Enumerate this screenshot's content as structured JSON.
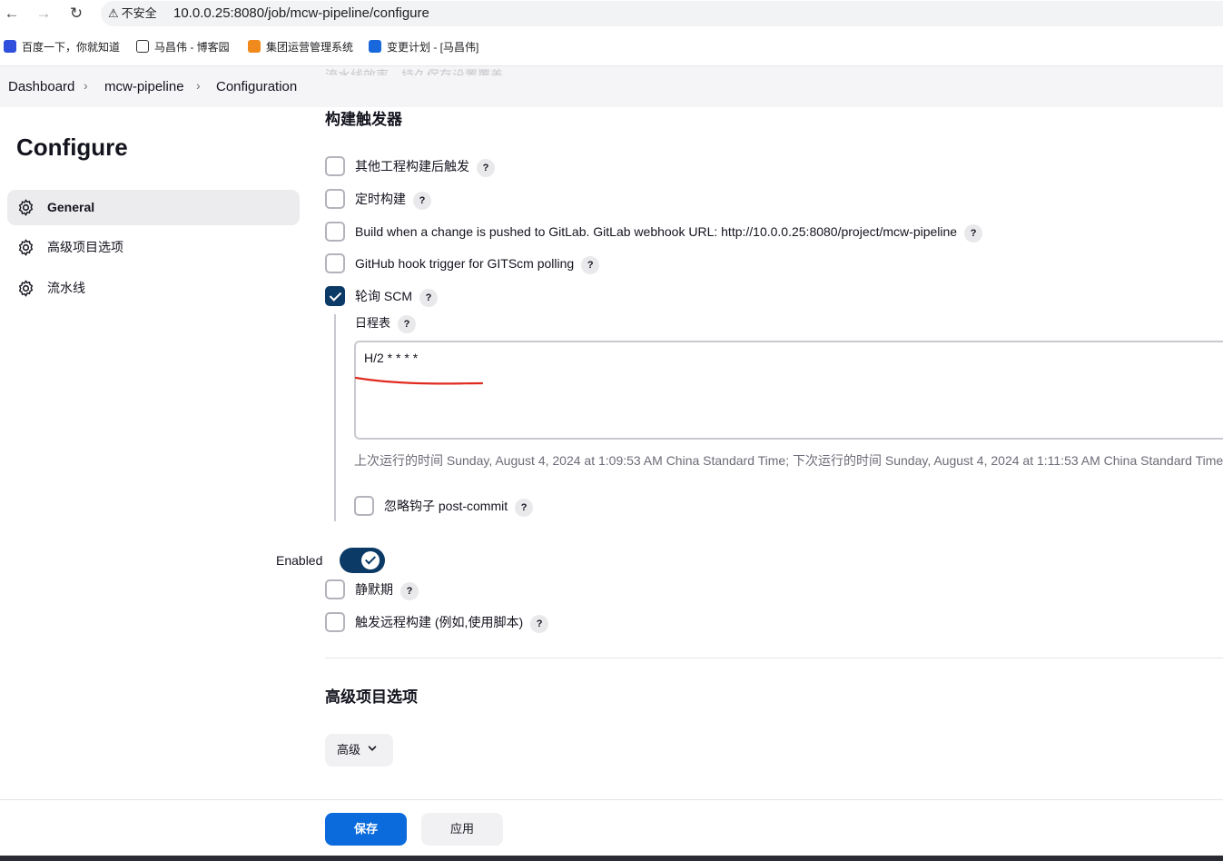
{
  "browser": {
    "insecure_label": "不安全",
    "url": "10.0.0.25:8080/job/mcw-pipeline/configure",
    "bookmarks": [
      {
        "label": "百度一下，你就知道",
        "icon": "baidu-icon",
        "color": "#2f4fdc"
      },
      {
        "label": "马昌伟 - 博客园",
        "icon": "cnblogs-icon",
        "color": "#333333"
      },
      {
        "label": "集团运营管理系统",
        "icon": "ops-system-icon",
        "color": "#f08a1c"
      },
      {
        "label": "变更计划 - [马昌伟]",
        "icon": "confluence-icon",
        "color": "#1868db"
      }
    ]
  },
  "breadcrumb": {
    "items": [
      "Dashboard",
      "mcw-pipeline",
      "Configuration"
    ],
    "faded_text": "流水线效率，持久保存设置覆盖"
  },
  "sidebar": {
    "title": "Configure",
    "items": [
      {
        "label": "General",
        "active": true
      },
      {
        "label": "高级项目选项",
        "active": false
      },
      {
        "label": "流水线",
        "active": false
      }
    ]
  },
  "triggers": {
    "title": "构建触发器",
    "options": [
      {
        "label": "其他工程构建后触发",
        "checked": false
      },
      {
        "label": "定时构建",
        "checked": false
      },
      {
        "label": "Build when a change is pushed to GitLab. GitLab webhook URL: http://10.0.0.25:8080/project/mcw-pipeline",
        "checked": false
      },
      {
        "label": "GitHub hook trigger for GITScm polling",
        "checked": false
      },
      {
        "label": "轮询 SCM",
        "checked": true
      }
    ],
    "schedule_label": "日程表",
    "schedule_value": "H/2 * * * *",
    "run_info": "上次运行的时间 Sunday, August 4, 2024 at 1:09:53 AM China Standard Time; 下次运行的时间 Sunday, August 4, 2024 at 1:11:53 AM China Standard Time.",
    "ignore_post_commit": {
      "label": "忽略钩子 post-commit",
      "checked": false
    }
  },
  "enabled": {
    "label": "Enabled",
    "on": true
  },
  "extra_options": [
    {
      "label": "静默期",
      "checked": false
    },
    {
      "label": "触发远程构建 (例如,使用脚本)",
      "checked": false
    }
  ],
  "advanced_section": {
    "title": "高级项目选项",
    "button_label": "高级"
  },
  "actions": {
    "save_label": "保存",
    "apply_label": "应用"
  },
  "help_label": "?",
  "colors": {
    "primary": "#0b6bdc",
    "checked": "#0b3a66",
    "annotation": "#e02b20"
  }
}
